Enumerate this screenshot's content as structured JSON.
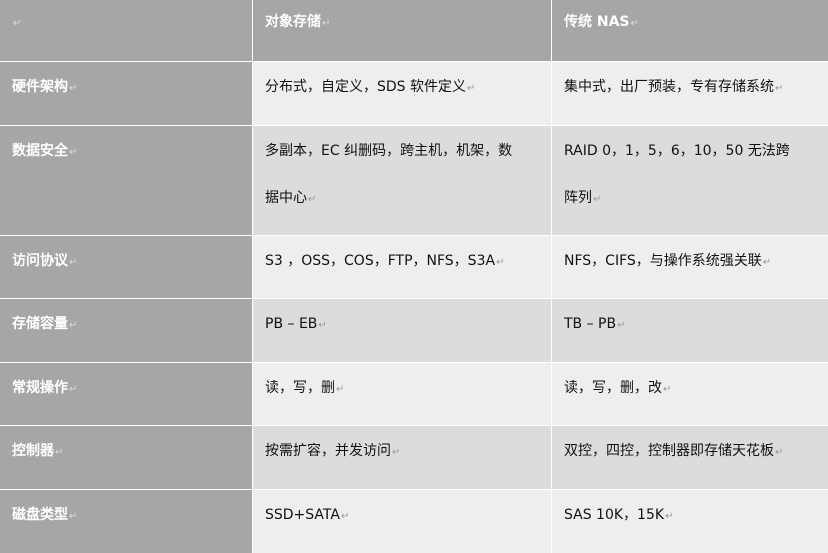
{
  "header": {
    "corner_mark": "↵",
    "col1": "对象存储",
    "col2": "传统 NAS"
  },
  "rows": [
    {
      "label": "硬件架构",
      "obj": "分布式，自定义，SDS  软件定义",
      "nas": "集中式，出厂预装，专有存储系统"
    },
    {
      "label": "数据安全",
      "obj_line1": "多副本，EC  纠删码，跨主机，机架，数",
      "obj_line2": "据中心",
      "nas_line1": "RAID 0，1，5，6，10，50    无法跨",
      "nas_line2": "阵列"
    },
    {
      "label": "访问协议",
      "obj": "S3 ，OSS，COS，FTP，NFS，S3A",
      "nas": "NFS，CIFS，与操作系统强关联"
    },
    {
      "label": "存储容量",
      "obj": "PB – EB",
      "nas": "TB – PB"
    },
    {
      "label": "常规操作",
      "obj": "读，写，删",
      "nas": "读，写，删，改"
    },
    {
      "label": "控制器",
      "obj": "按需扩容，并发访问",
      "nas": "双控，四控，控制器即存储天花板"
    },
    {
      "label": "磁盘类型",
      "obj": "SSD+SATA",
      "nas": "SAS 10K，15K"
    }
  ],
  "paragraph_mark": "↵"
}
